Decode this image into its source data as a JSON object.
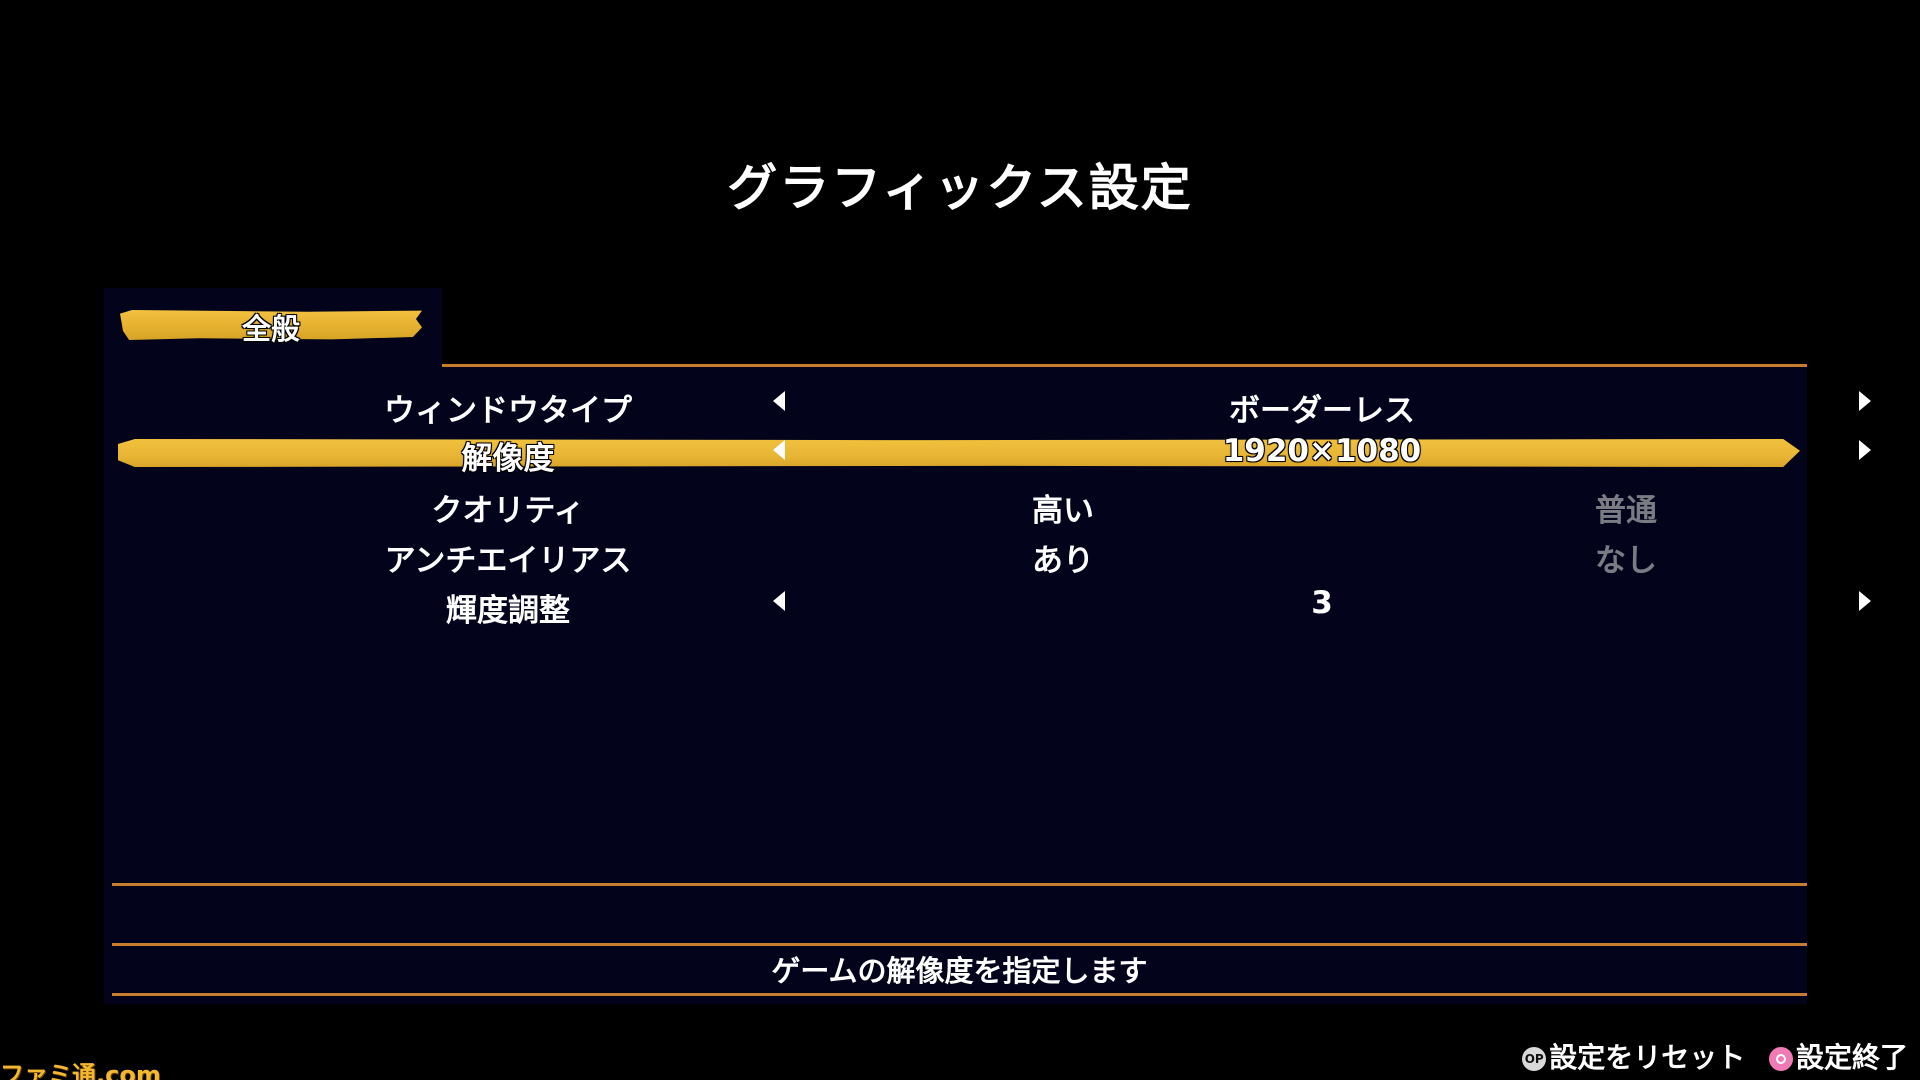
{
  "screen": {
    "title": "グラフィックス設定"
  },
  "tabs": [
    {
      "label": "全般",
      "selected": true
    }
  ],
  "settings": [
    {
      "label": "ウィンドウタイプ",
      "value": "ボーダーレス",
      "type": "selector",
      "selected": false
    },
    {
      "label": "解像度",
      "value": "1920×1080",
      "type": "selector",
      "selected": true
    },
    {
      "label": "クオリティ",
      "type": "toggle",
      "options": [
        "高い",
        "普通"
      ],
      "selected_option": "高い",
      "selected": false
    },
    {
      "label": "アンチエイリアス",
      "type": "toggle",
      "options": [
        "あり",
        "なし"
      ],
      "selected_option": "あり",
      "selected": false
    },
    {
      "label": "輝度調整",
      "value": "3",
      "type": "selector",
      "selected": false
    }
  ],
  "description": "ゲームの解像度を指定します",
  "footer": {
    "reset_label": "設定をリセット",
    "reset_icon": "options-button-icon",
    "exit_label": "設定終了",
    "exit_icon": "circle-button-icon"
  },
  "watermark": "ファミ通.com",
  "colors": {
    "background": "#000000",
    "panel": "#03041c",
    "accent": "#e8b535",
    "divider": "#c77d2d",
    "inactive_text": "#7b7b84",
    "text": "#ffffff"
  }
}
